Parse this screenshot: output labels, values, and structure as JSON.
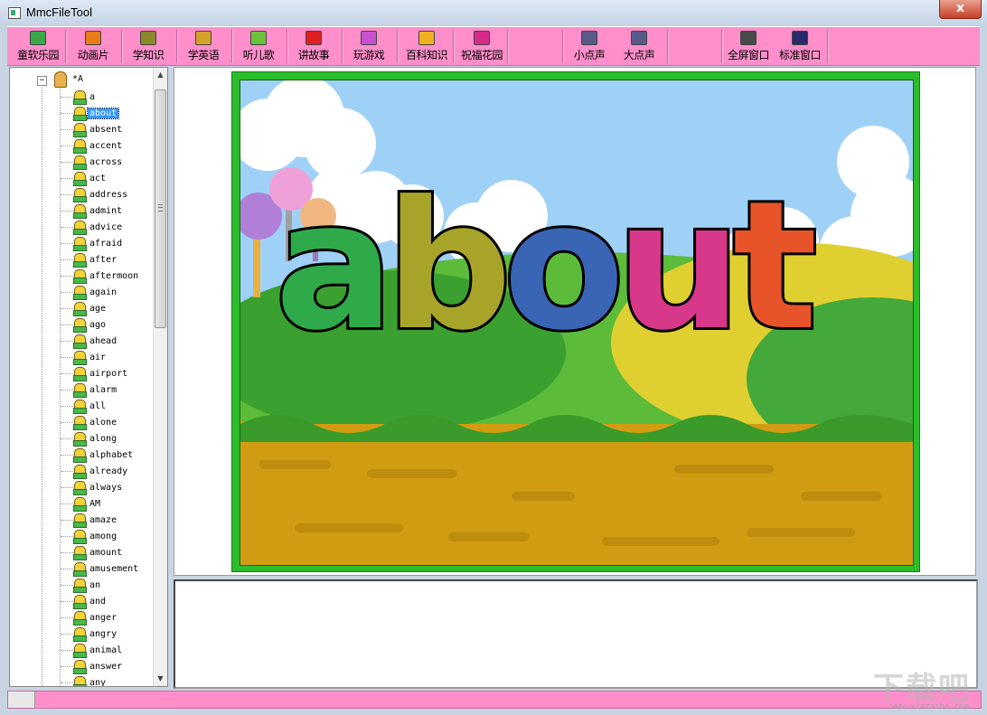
{
  "window": {
    "title": "MmcFileTool",
    "close_label": "x"
  },
  "toolbar": {
    "buttons": [
      {
        "label": "童软乐园",
        "icon": "kids-icon",
        "color": "#3aa84a"
      },
      {
        "label": "动画片",
        "icon": "cartoon-icon",
        "color": "#e67c1a"
      },
      {
        "label": "学知识",
        "icon": "knowledge-icon",
        "color": "#8a8a2a"
      },
      {
        "label": "学英语",
        "icon": "english-icon",
        "color": "#d4a02a"
      },
      {
        "label": "听儿歌",
        "icon": "song-icon",
        "color": "#6cc13a"
      },
      {
        "label": "讲故事",
        "icon": "story-icon",
        "color": "#e02020"
      },
      {
        "label": "玩游戏",
        "icon": "game-icon",
        "color": "#c850d0"
      },
      {
        "label": "百科知识",
        "icon": "encyclopedia-icon",
        "color": "#f0b020"
      },
      {
        "label": "祝福花园",
        "icon": "garden-icon",
        "color": "#d82a8a"
      },
      {
        "label": "小点声",
        "icon": "volume-down-icon",
        "color": "#5a5a8a"
      },
      {
        "label": "大点声",
        "icon": "volume-up-icon",
        "color": "#5a5a8a"
      },
      {
        "label": "全屏窗口",
        "icon": "fullscreen-icon",
        "color": "#4a4a4a"
      },
      {
        "label": "标准窗口",
        "icon": "standard-window-icon",
        "color": "#2a2a6a"
      }
    ]
  },
  "tree": {
    "root_label": "*A",
    "expander": "−",
    "selected": "about",
    "items": [
      "a",
      "about",
      "absent",
      "accent",
      "across",
      "act",
      "address",
      "admint",
      "advice",
      "afraid",
      "after",
      "aftermoon",
      "again",
      "age",
      "ago",
      "ahead",
      "air",
      "airport",
      "alarm",
      "all",
      "alone",
      "along",
      "alphabet",
      "already",
      "always",
      "AM",
      "amaze",
      "among",
      "amount",
      "amusement",
      "an",
      "and",
      "anger",
      "angry",
      "animal",
      "answer",
      "any"
    ]
  },
  "display": {
    "word_letters": [
      {
        "char": "a",
        "color": "#2faa4a"
      },
      {
        "char": "b",
        "color": "#a8a42a"
      },
      {
        "char": "o",
        "color": "#3a64b4"
      },
      {
        "char": "u",
        "color": "#d8388a"
      },
      {
        "char": "t",
        "color": "#e8542a"
      }
    ]
  },
  "watermark": {
    "main": "下载吧",
    "sub": "www.xiazaiba.com"
  }
}
